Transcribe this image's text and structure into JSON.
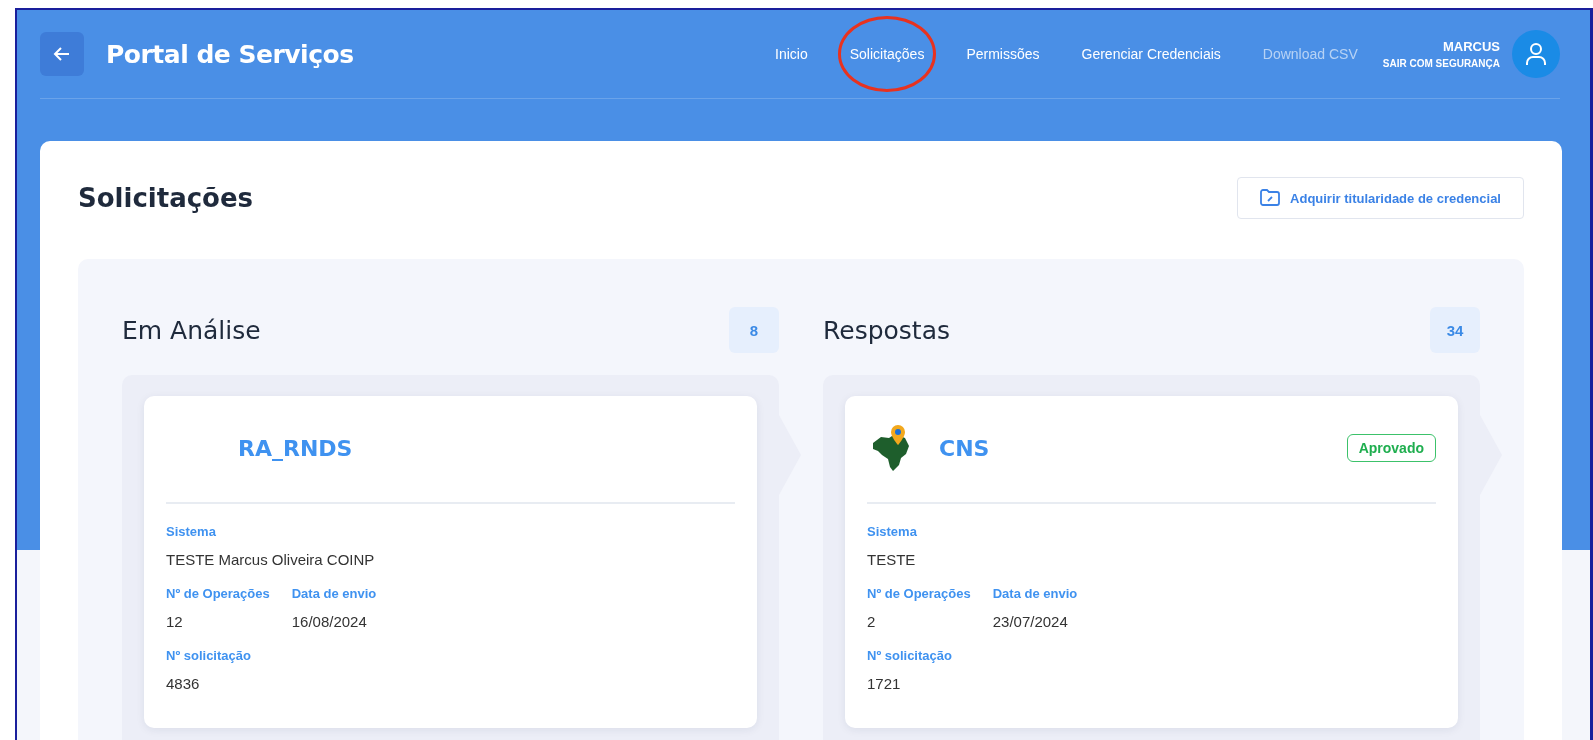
{
  "header": {
    "title": "Portal de Serviços",
    "nav": [
      {
        "label": "Inicio",
        "disabled": false,
        "circled": false
      },
      {
        "label": "Solicitações",
        "disabled": false,
        "circled": true
      },
      {
        "label": "Permissões",
        "disabled": false,
        "circled": false
      },
      {
        "label": "Gerenciar Credenciais",
        "disabled": false,
        "circled": false
      },
      {
        "label": "Download CSV",
        "disabled": true,
        "circled": false
      }
    ],
    "user": {
      "name": "MARCUS",
      "logout": "SAIR COM SEGURANÇA"
    }
  },
  "page": {
    "title": "Solicitações",
    "action": "Adquirir titularidade de credencial"
  },
  "columns": [
    {
      "title": "Em Análise",
      "count": "8",
      "cards": [
        {
          "title": "RA_RNDS",
          "has_icon": false,
          "sistema_label": "Sistema",
          "sistema": "TESTE Marcus Oliveira COINP",
          "ops_label": "Nº de Operações",
          "ops": "12",
          "date_label": "Data de envio",
          "date": "16/08/2024",
          "num_label": "Nº solicitação",
          "num": "4836"
        }
      ]
    },
    {
      "title": "Respostas",
      "count": "34",
      "cards": [
        {
          "title": "CNS",
          "has_icon": true,
          "status": "Aprovado",
          "sistema_label": "Sistema",
          "sistema": "TESTE",
          "ops_label": "Nº de Operações",
          "ops": "2",
          "date_label": "Data de envio",
          "date": "23/07/2024",
          "num_label": "Nº solicitação",
          "num": "1721"
        }
      ]
    }
  ]
}
